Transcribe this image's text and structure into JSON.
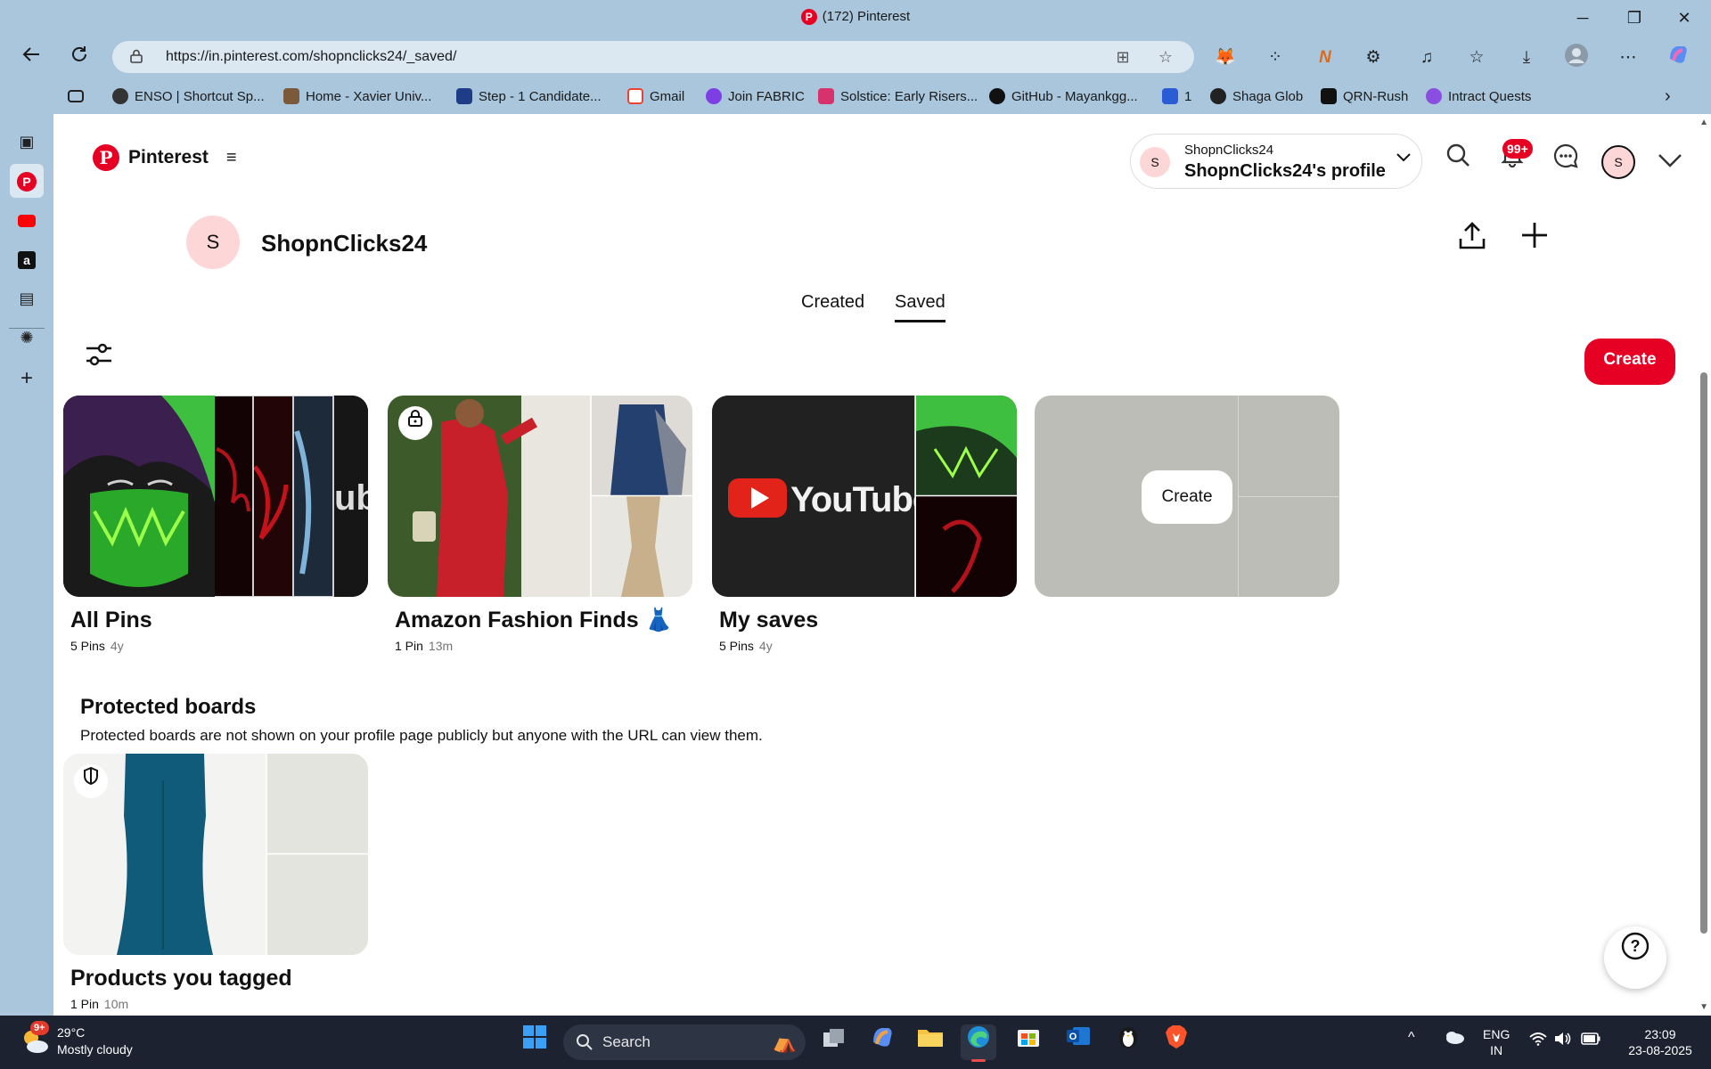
{
  "browser": {
    "window_title": "(172) Pinterest",
    "url": "https://in.pinterest.com/shopnclicks24/_saved/",
    "controls": {
      "minimize": "─",
      "maximize": "❐",
      "close": "✕"
    }
  },
  "bookmarks": [
    {
      "label": "ENSO | Shortcut Sp...",
      "color": "#333333"
    },
    {
      "label": "Home - Xavier Univ...",
      "color": "#7a5a3a"
    },
    {
      "label": "Step - 1 Candidate...",
      "color": "#1f3c88"
    },
    {
      "label": "Gmail",
      "color": "#ea4335"
    },
    {
      "label": "Join FABRIC",
      "color": "#7b3fe4"
    },
    {
      "label": "Solstice: Early Risers...",
      "color": "#d6336c"
    },
    {
      "label": "GitHub - Mayankgg...",
      "color": "#111111"
    },
    {
      "label": "1",
      "color": "#2b5cd6"
    },
    {
      "label": "Shaga Glob",
      "color": "#222222"
    },
    {
      "label": "QRN-Rush",
      "color": "#111111"
    },
    {
      "label": "Intract Quests",
      "color": "#8a4fe0"
    }
  ],
  "pinterest": {
    "logo_text": "Pinterest",
    "profile_switcher": {
      "account": "ShopnClicks24",
      "label": "ShopnClicks24's profile",
      "avatar_letter": "S"
    },
    "notification_badge": "99+",
    "header_avatar_letter": "S",
    "user": {
      "avatar_letter": "S",
      "name": "ShopnClicks24"
    },
    "tabs": [
      {
        "label": "Created"
      },
      {
        "label": "Saved"
      }
    ],
    "create_label": "Create",
    "boards": [
      {
        "name": "All Pins",
        "pins": "5 Pins",
        "age": "4y"
      },
      {
        "name": "Amazon Fashion Finds 👗",
        "pins": "1 Pin",
        "age": "13m"
      },
      {
        "name": "My saves",
        "pins": "5 Pins",
        "age": "4y",
        "cover_text": "YouTube"
      }
    ],
    "create_tile_label": "Create",
    "protected": {
      "title": "Protected boards",
      "description": "Protected boards are not shown on your profile page publicly but anyone with the URL can view them.",
      "boards": [
        {
          "name": "Products you tagged",
          "pins": "1 Pin",
          "age": "10m"
        }
      ]
    },
    "help_label": "?"
  },
  "taskbar": {
    "weather_badge": "9+",
    "temperature": "29°C",
    "condition": "Mostly cloudy",
    "search_label": "Search",
    "lang_1": "ENG",
    "lang_2": "IN",
    "time": "23:09",
    "date": "23-08-2025"
  },
  "colors": {
    "accent": "#e60023",
    "browser_frame": "#a9c6dc",
    "taskbar": "#1c2230"
  }
}
